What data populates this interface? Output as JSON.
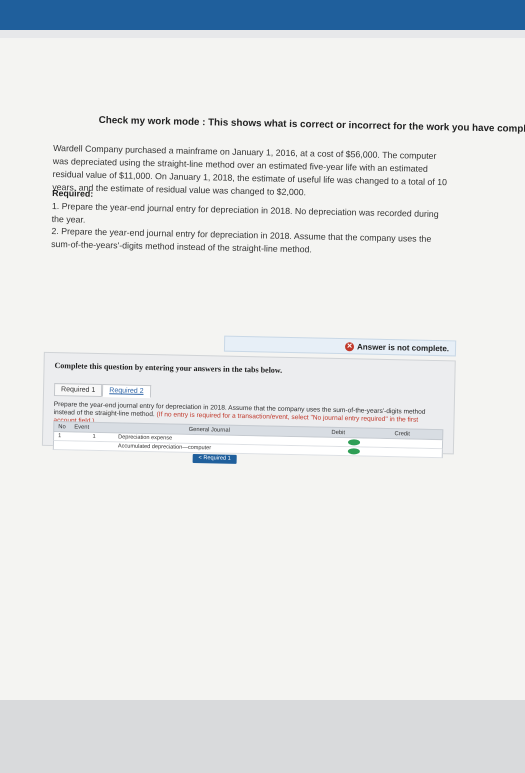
{
  "banner": "Check my work mode : This shows what is correct or incorrect for the work you have completed so far. It does not indicate co",
  "problem": "Wardell Company purchased a mainframe on January 1, 2016, at a cost of $56,000. The computer was depreciated using the straight-line method over an estimated five-year life with an estimated residual value of $11,000. On January 1, 2018, the estimate of useful life was changed to a total of 10 years, and the estimate of residual value was changed to $2,000.",
  "required_title": "Required:",
  "required": [
    "1. Prepare the year-end journal entry for depreciation in 2018. No depreciation was recorded during the year.",
    "2. Prepare the year-end journal entry for depreciation in 2018. Assume that the company uses the sum-of-the-years'-digits method instead of the straight-line method."
  ],
  "alert": "Answer is not complete.",
  "panel_title": "Complete this question by entering your answers in the tabs below.",
  "tabs": [
    "Required 1",
    "Required 2"
  ],
  "prepare": "Prepare the year-end journal entry for depreciation in 2018. Assume that the company uses the sum-of-the-years'-digits method instead of the straight-line method.",
  "prepare_note": "(If no entry is required for a transaction/event, select \"No journal entry required\" in the first account field.)",
  "table": {
    "headers": [
      "No",
      "Event",
      "General Journal",
      "Debit",
      "Credit"
    ],
    "rows": [
      {
        "no": "1",
        "event": "1",
        "account": "Depreciation expense"
      },
      {
        "no": "",
        "event": "",
        "account": "Accumulated depreciation—computer"
      }
    ]
  },
  "back_button": "< Required 1",
  "colors": {
    "topbar": "#1f5f9c",
    "correct": "#2e9e55",
    "error": "#c0392b"
  }
}
